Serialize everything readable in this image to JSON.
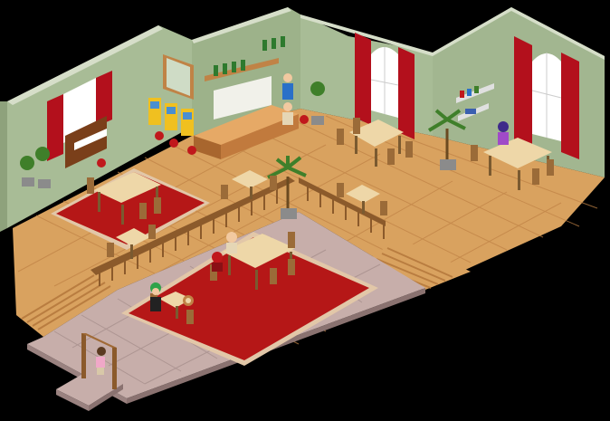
{
  "scene": {
    "kind": "isometric-pixel-room",
    "palette": {
      "background": "#000000",
      "wall": "#a8bc96",
      "wall_shadow": "#8ea27c",
      "wall_trim": "#d6dec9",
      "wood_floor": "#d9a25f",
      "wood_floor_dark": "#c08346",
      "stone_floor": "#c7aeaa",
      "stone_floor_dark": "#ad9592",
      "carpet": "#b51717",
      "carpet_border": "#e2c7a8",
      "table_top": "#eed7a8",
      "chair_wood": "#9b6b38",
      "curtain": "#b3101c",
      "window_glass": "#ffffff",
      "railing": "#8b5a2b",
      "plant": "#3f7f2a",
      "pot": "#8b8b8b",
      "counter": "#c17a3d"
    },
    "icons": [
      "piano-icon",
      "arcade-machine-icon",
      "potted-tree-icon",
      "palm-plant-icon",
      "bar-stool-icon",
      "bookshelf-icon",
      "wine-bottles-icon",
      "painting-icon"
    ]
  }
}
